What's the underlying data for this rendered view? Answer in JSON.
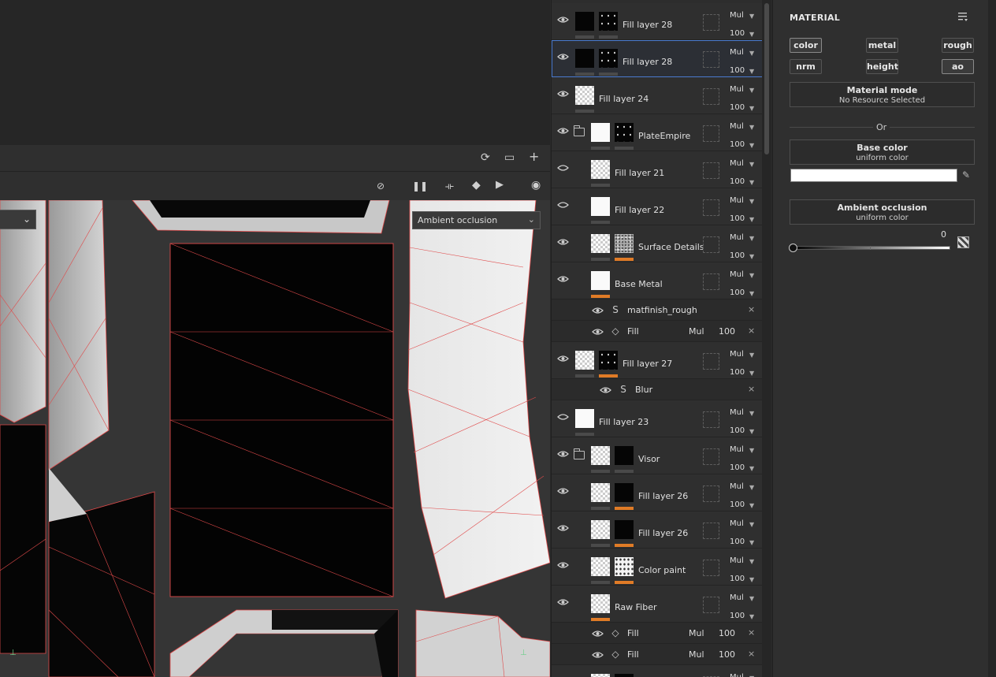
{
  "viewport": {
    "channel_select": "Ambient occlusion",
    "left_select": ""
  },
  "layers": [
    {
      "name": "Fill layer 28",
      "blend": "Mul",
      "opacity": "100"
    },
    {
      "name": "Fill layer 28",
      "blend": "Mul",
      "opacity": "100"
    },
    {
      "name": "Fill layer 24",
      "blend": "Mul",
      "opacity": "100"
    },
    {
      "name": "PlateEmpire",
      "blend": "Mul",
      "opacity": "100"
    },
    {
      "name": "Fill layer 21",
      "blend": "Mul",
      "opacity": "100"
    },
    {
      "name": "Fill layer 22",
      "blend": "Mul",
      "opacity": "100"
    },
    {
      "name": "Surface Details",
      "blend": "Mul",
      "opacity": "100"
    },
    {
      "name": "Base Metal",
      "blend": "Mul",
      "opacity": "100"
    },
    {
      "name": "Fill layer 27",
      "blend": "Mul",
      "opacity": "100"
    },
    {
      "name": "Fill layer 23",
      "blend": "Mul",
      "opacity": "100"
    },
    {
      "name": "Visor",
      "blend": "Mul",
      "opacity": "100"
    },
    {
      "name": "Fill layer 26",
      "blend": "Mul",
      "opacity": "100"
    },
    {
      "name": "Fill layer 26",
      "blend": "Mul",
      "opacity": "100"
    },
    {
      "name": "Color paint",
      "blend": "Mul",
      "opacity": "100"
    },
    {
      "name": "Raw Fiber",
      "blend": "Mul",
      "opacity": "100"
    },
    {
      "name": "",
      "blend": "Mul",
      "opacity": ""
    }
  ],
  "effects": [
    {
      "name": "matfinish_rough",
      "blend": "",
      "opacity": ""
    },
    {
      "name": "Fill",
      "blend": "Mul",
      "opacity": "100"
    },
    {
      "name": "Blur",
      "blend": "",
      "opacity": ""
    },
    {
      "name": "Fill",
      "blend": "Mul",
      "opacity": "100"
    },
    {
      "name": "Fill",
      "blend": "Mul",
      "opacity": "100"
    }
  ],
  "properties": {
    "title": "MATERIAL",
    "channels": {
      "color": "color",
      "metal": "metal",
      "rough": "rough",
      "nrm": "nrm",
      "height": "height",
      "ao": "ao"
    },
    "material_mode": {
      "title": "Material mode",
      "value": "No Resource Selected"
    },
    "or_label": "Or",
    "base_color": {
      "title": "Base color",
      "value": "uniform color",
      "swatch": "#ffffff"
    },
    "ambient_occlusion": {
      "title": "Ambient occlusion",
      "value": "uniform color",
      "amount": "0"
    }
  },
  "colors": {
    "accent": "#4a7bd0",
    "highlight_bar": "#e07b26",
    "uv_edges": "#e04a4a"
  }
}
